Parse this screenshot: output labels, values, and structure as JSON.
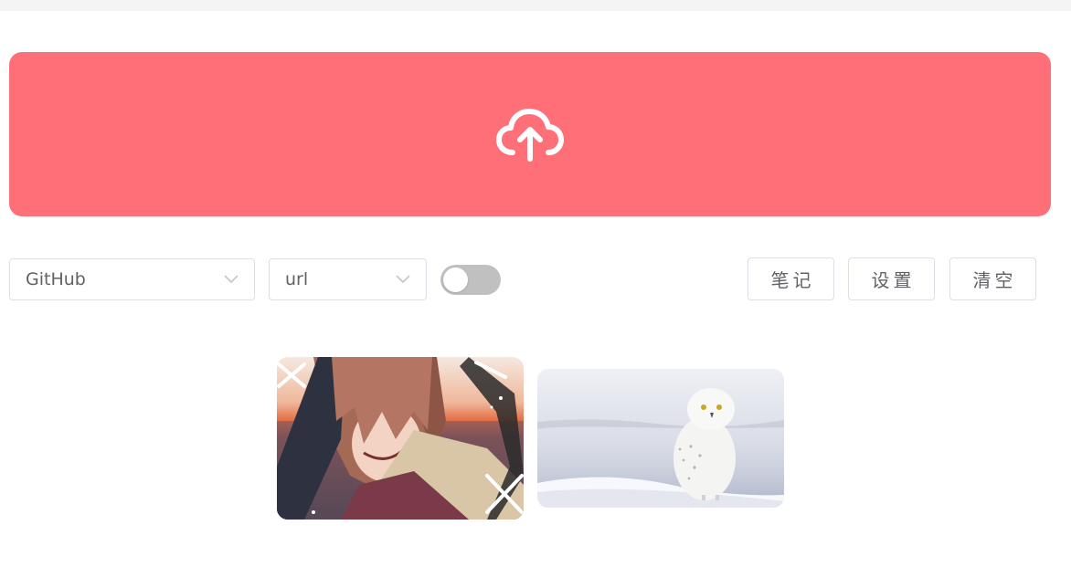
{
  "upload": {
    "icon": "cloud-upload-icon",
    "bg_color": "#ff6f78"
  },
  "controls": {
    "host_select": {
      "value": "GitHub"
    },
    "format_select": {
      "value": "url"
    },
    "toggle": {
      "on": false
    },
    "buttons": {
      "notes": "笔记",
      "settings": "设置",
      "clear": "清空"
    }
  },
  "gallery": {
    "images": [
      {
        "name": "anime-illustration"
      },
      {
        "name": "snowy-owl-photo"
      }
    ]
  }
}
